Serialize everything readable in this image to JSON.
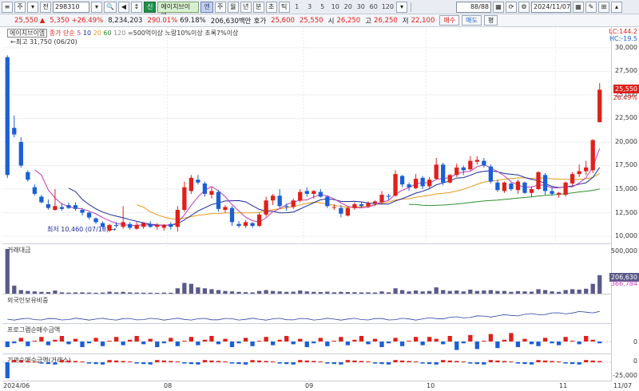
{
  "toolbar": {
    "mode": "주",
    "nav_label": "전",
    "code": "298310",
    "credit_badge": "신",
    "stock_name": "에이치브이엠",
    "market_badge": "엔",
    "period_buttons": [
      "주",
      "월",
      "년",
      "분",
      "초",
      "틱"
    ],
    "interval_buttons": [
      "1",
      "3",
      "5",
      "10",
      "20",
      "30",
      "60",
      "120"
    ],
    "page_count": "88/88",
    "date": "2024/11/07"
  },
  "quote": {
    "price": "25,550",
    "change_arrow": "▲",
    "change": "5,350",
    "change_pct": "+26.49%",
    "volume": "8,234,203",
    "vol_ratio": "290.01%",
    "turnover": "69.18%",
    "trade_value": "206,630백만",
    "ask_label": "호가",
    "ask": "25,600",
    "bid": "25,550",
    "open_label": "시",
    "open": "26,250",
    "high_label": "고",
    "high": "26,250",
    "low_label": "저",
    "low": "22,100",
    "buy_label": "매수",
    "sell_label": "매도",
    "eval_label": "평"
  },
  "price_pane": {
    "legend": {
      "name": "에이치브이엠",
      "ma_prefix": "종가 단순",
      "ma_periods": [
        "5",
        "10",
        "20",
        "60",
        "120"
      ],
      "ma_colors": [
        "#c13cb6",
        "#1b2a9a",
        "#e49a1a",
        "#2f8f2f",
        "#8a8a8a"
      ],
      "filter_text": "=500억이상 노랑10%이상 초록7%이상"
    },
    "high_note": "최고 31,750 (06/20)",
    "low_note": "최저 10,460 (07/18)",
    "lc_label": "LC:144.2",
    "hc_label": "HC:-19.5",
    "last_price": "25,550",
    "last_change": "26.49%"
  },
  "panes": {
    "volume_title": "거래대금",
    "volume_max": "500,000",
    "volume_tag_top": "206,630",
    "volume_tag_bottom": "366,784",
    "foreign_title": "외국인보유비중",
    "program_title": "프로그램순매수금액",
    "program_zero": "0",
    "inst_title": "기관순매수금액(거래소)",
    "inst_zero": "0",
    "inst_low": "-25,000"
  },
  "x_axis": [
    "2024/06",
    "08",
    "09",
    "10",
    "11",
    "11/07"
  ],
  "chart_data": {
    "type": "candlestick",
    "y_axis_ticks": [
      10000,
      12500,
      15000,
      17500,
      20000,
      22500,
      25000,
      27500,
      30000
    ],
    "ylim": [
      9500,
      31000
    ],
    "candles": [
      {
        "o": 29000,
        "h": 29200,
        "l": 16200,
        "c": 16500
      },
      {
        "o": 21500,
        "h": 22800,
        "l": 20500,
        "c": 20800
      },
      {
        "o": 20000,
        "h": 20500,
        "l": 17300,
        "c": 17500
      },
      {
        "o": 16800,
        "h": 17000,
        "l": 15800,
        "c": 16000
      },
      {
        "o": 15200,
        "h": 15500,
        "l": 14300,
        "c": 14500
      },
      {
        "o": 14200,
        "h": 14400,
        "l": 13500,
        "c": 13600
      },
      {
        "o": 13400,
        "h": 13900,
        "l": 12800,
        "c": 13000
      },
      {
        "o": 12800,
        "h": 15000,
        "l": 12700,
        "c": 13200
      },
      {
        "o": 13100,
        "h": 13500,
        "l": 12700,
        "c": 12900
      },
      {
        "o": 13300,
        "h": 13600,
        "l": 12900,
        "c": 13000
      },
      {
        "o": 13300,
        "h": 13600,
        "l": 12700,
        "c": 12900
      },
      {
        "o": 12800,
        "h": 13000,
        "l": 12200,
        "c": 12500
      },
      {
        "o": 12500,
        "h": 12600,
        "l": 11800,
        "c": 12000
      },
      {
        "o": 11900,
        "h": 12000,
        "l": 11300,
        "c": 11500
      },
      {
        "o": 11400,
        "h": 11600,
        "l": 10800,
        "c": 11000
      },
      {
        "o": 10600,
        "h": 11300,
        "l": 10460,
        "c": 11200
      },
      {
        "o": 11200,
        "h": 11500,
        "l": 10900,
        "c": 11100
      },
      {
        "o": 11000,
        "h": 13200,
        "l": 10800,
        "c": 11500
      },
      {
        "o": 11300,
        "h": 11500,
        "l": 10700,
        "c": 10900
      },
      {
        "o": 10800,
        "h": 11500,
        "l": 10700,
        "c": 11200
      },
      {
        "o": 11000,
        "h": 11500,
        "l": 10800,
        "c": 11400
      },
      {
        "o": 11300,
        "h": 11600,
        "l": 10900,
        "c": 11000
      },
      {
        "o": 11000,
        "h": 11400,
        "l": 10700,
        "c": 11200
      },
      {
        "o": 10900,
        "h": 11300,
        "l": 10600,
        "c": 11200
      },
      {
        "o": 11300,
        "h": 11500,
        "l": 10700,
        "c": 11000
      },
      {
        "o": 11000,
        "h": 13200,
        "l": 10500,
        "c": 12800
      },
      {
        "o": 12800,
        "h": 15800,
        "l": 12600,
        "c": 15200
      },
      {
        "o": 14800,
        "h": 16500,
        "l": 14500,
        "c": 16200
      },
      {
        "o": 16000,
        "h": 16500,
        "l": 15500,
        "c": 15700
      },
      {
        "o": 15600,
        "h": 15800,
        "l": 14200,
        "c": 14500
      },
      {
        "o": 14400,
        "h": 15200,
        "l": 14000,
        "c": 14800
      },
      {
        "o": 14700,
        "h": 14900,
        "l": 12600,
        "c": 12900
      },
      {
        "o": 12800,
        "h": 13300,
        "l": 12500,
        "c": 13100
      },
      {
        "o": 13000,
        "h": 13200,
        "l": 11100,
        "c": 11500
      },
      {
        "o": 11300,
        "h": 11600,
        "l": 10900,
        "c": 11100
      },
      {
        "o": 11100,
        "h": 11700,
        "l": 10900,
        "c": 11500
      },
      {
        "o": 11400,
        "h": 11500,
        "l": 10900,
        "c": 11100
      },
      {
        "o": 11100,
        "h": 12500,
        "l": 11000,
        "c": 12300
      },
      {
        "o": 12300,
        "h": 14200,
        "l": 12100,
        "c": 13800
      },
      {
        "o": 13800,
        "h": 14500,
        "l": 13300,
        "c": 14300
      },
      {
        "o": 14300,
        "h": 15000,
        "l": 13000,
        "c": 13200
      },
      {
        "o": 13200,
        "h": 13500,
        "l": 12700,
        "c": 13100
      },
      {
        "o": 13100,
        "h": 14000,
        "l": 12900,
        "c": 13800
      },
      {
        "o": 13800,
        "h": 15000,
        "l": 13600,
        "c": 14700
      },
      {
        "o": 14800,
        "h": 15200,
        "l": 14200,
        "c": 14500
      },
      {
        "o": 14500,
        "h": 14900,
        "l": 14000,
        "c": 14800
      },
      {
        "o": 14700,
        "h": 15000,
        "l": 14100,
        "c": 14200
      },
      {
        "o": 14200,
        "h": 14300,
        "l": 13000,
        "c": 13200
      },
      {
        "o": 13100,
        "h": 13400,
        "l": 12800,
        "c": 13100
      },
      {
        "o": 13000,
        "h": 13300,
        "l": 12000,
        "c": 12400
      },
      {
        "o": 12200,
        "h": 13100,
        "l": 12100,
        "c": 13000
      },
      {
        "o": 13000,
        "h": 13600,
        "l": 12800,
        "c": 13400
      },
      {
        "o": 13400,
        "h": 13600,
        "l": 13000,
        "c": 13200
      },
      {
        "o": 13200,
        "h": 13700,
        "l": 13000,
        "c": 13500
      },
      {
        "o": 13500,
        "h": 13800,
        "l": 13200,
        "c": 13700
      },
      {
        "o": 13600,
        "h": 14800,
        "l": 13500,
        "c": 14400
      },
      {
        "o": 14300,
        "h": 14500,
        "l": 13800,
        "c": 14200
      },
      {
        "o": 14300,
        "h": 17000,
        "l": 14200,
        "c": 16600
      },
      {
        "o": 16400,
        "h": 16500,
        "l": 15200,
        "c": 15500
      },
      {
        "o": 15500,
        "h": 15700,
        "l": 14800,
        "c": 15200
      },
      {
        "o": 15100,
        "h": 16600,
        "l": 15000,
        "c": 16100
      },
      {
        "o": 16200,
        "h": 16400,
        "l": 15000,
        "c": 15300
      },
      {
        "o": 15300,
        "h": 16300,
        "l": 15100,
        "c": 16000
      },
      {
        "o": 16100,
        "h": 18300,
        "l": 16000,
        "c": 17600
      },
      {
        "o": 17600,
        "h": 17800,
        "l": 15400,
        "c": 15700
      },
      {
        "o": 15700,
        "h": 16600,
        "l": 15600,
        "c": 16500
      },
      {
        "o": 16500,
        "h": 17700,
        "l": 16300,
        "c": 17300
      },
      {
        "o": 17300,
        "h": 17500,
        "l": 16500,
        "c": 17000
      },
      {
        "o": 17100,
        "h": 18500,
        "l": 17000,
        "c": 18000
      },
      {
        "o": 17900,
        "h": 18500,
        "l": 17600,
        "c": 18100
      },
      {
        "o": 18000,
        "h": 18300,
        "l": 17300,
        "c": 17500
      },
      {
        "o": 17400,
        "h": 17600,
        "l": 15600,
        "c": 15800
      },
      {
        "o": 15700,
        "h": 16000,
        "l": 14700,
        "c": 14900
      },
      {
        "o": 14800,
        "h": 15800,
        "l": 14600,
        "c": 15700
      },
      {
        "o": 15600,
        "h": 15700,
        "l": 14800,
        "c": 15000
      },
      {
        "o": 14900,
        "h": 16000,
        "l": 14500,
        "c": 15800
      },
      {
        "o": 15700,
        "h": 15800,
        "l": 14500,
        "c": 14600
      },
      {
        "o": 14600,
        "h": 15300,
        "l": 14200,
        "c": 15000
      },
      {
        "o": 15000,
        "h": 16900,
        "l": 14900,
        "c": 16800
      },
      {
        "o": 16500,
        "h": 16700,
        "l": 14400,
        "c": 14800
      },
      {
        "o": 14800,
        "h": 15200,
        "l": 14300,
        "c": 14500
      },
      {
        "o": 14400,
        "h": 14700,
        "l": 14100,
        "c": 14600
      },
      {
        "o": 14400,
        "h": 15800,
        "l": 14200,
        "c": 15700
      },
      {
        "o": 15600,
        "h": 16800,
        "l": 15400,
        "c": 16600
      },
      {
        "o": 16600,
        "h": 17600,
        "l": 16300,
        "c": 16900
      },
      {
        "o": 16900,
        "h": 18000,
        "l": 16500,
        "c": 17300
      },
      {
        "o": 17000,
        "h": 20300,
        "l": 16700,
        "c": 20200
      },
      {
        "o": 22100,
        "h": 26250,
        "l": 22100,
        "c": 25550
      }
    ],
    "volume": [
      500000,
      90000,
      40000,
      30000,
      25000,
      20000,
      18000,
      35000,
      15000,
      12000,
      14000,
      15000,
      12000,
      10000,
      12000,
      22000,
      15000,
      20000,
      14000,
      12000,
      11000,
      10000,
      9000,
      12000,
      10000,
      60000,
      120000,
      110000,
      70000,
      60000,
      50000,
      40000,
      30000,
      25000,
      20000,
      16000,
      14000,
      30000,
      40000,
      30000,
      25000,
      20000,
      22000,
      35000,
      25000,
      20000,
      18000,
      22000,
      15000,
      20000,
      18000,
      16000,
      14000,
      15000,
      13000,
      25000,
      15000,
      60000,
      40000,
      25000,
      35000,
      25000,
      30000,
      70000,
      40000,
      30000,
      35000,
      25000,
      45000,
      30000,
      35000,
      40000,
      30000,
      30000,
      20000,
      28000,
      25000,
      22000,
      50000,
      40000,
      25000,
      20000,
      40000,
      50000,
      45000,
      55000,
      110000,
      206630
    ]
  }
}
